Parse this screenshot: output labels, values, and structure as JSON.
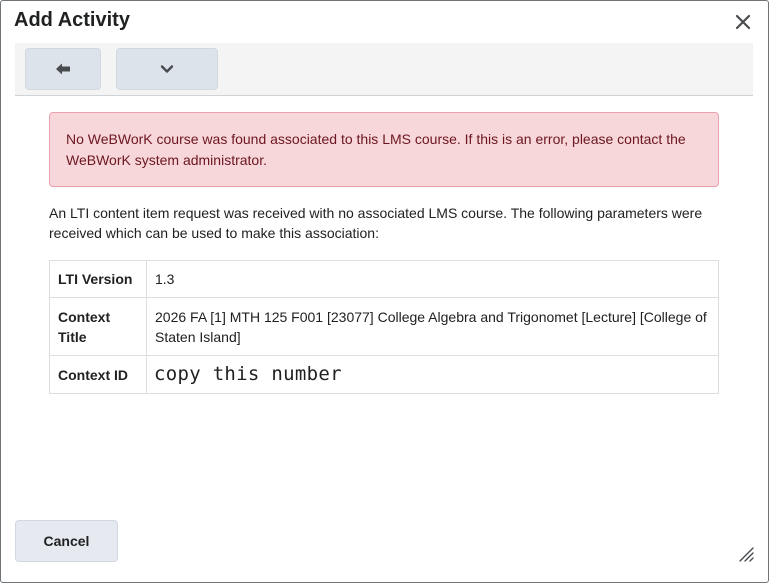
{
  "dialog": {
    "title": "Add Activity"
  },
  "toolbar": {
    "back_icon": "arrow-left-icon",
    "more_icon": "chevron-down-icon"
  },
  "alert": {
    "message": "No WeBWorK course was found associated to this LMS course. If this is an error, please contact the WeBWorK system administrator."
  },
  "intro": "An LTI content item request was received with no associated LMS course. The following parameters were received which can be used to make this association:",
  "params": [
    {
      "key": "LTI Version",
      "value": "1.3"
    },
    {
      "key": "Context Title",
      "value": "2026 FA [1] MTH 125 F001 [23077] College Algebra and Trigonomet [Lecture] [College of Staten Island]"
    },
    {
      "key": "Context ID",
      "value": "copy this number"
    }
  ],
  "footer": {
    "cancel_label": "Cancel"
  },
  "colors": {
    "alert_bg": "#f8d7da",
    "alert_text": "#6b1620",
    "button_bg": "#dce3eb"
  }
}
